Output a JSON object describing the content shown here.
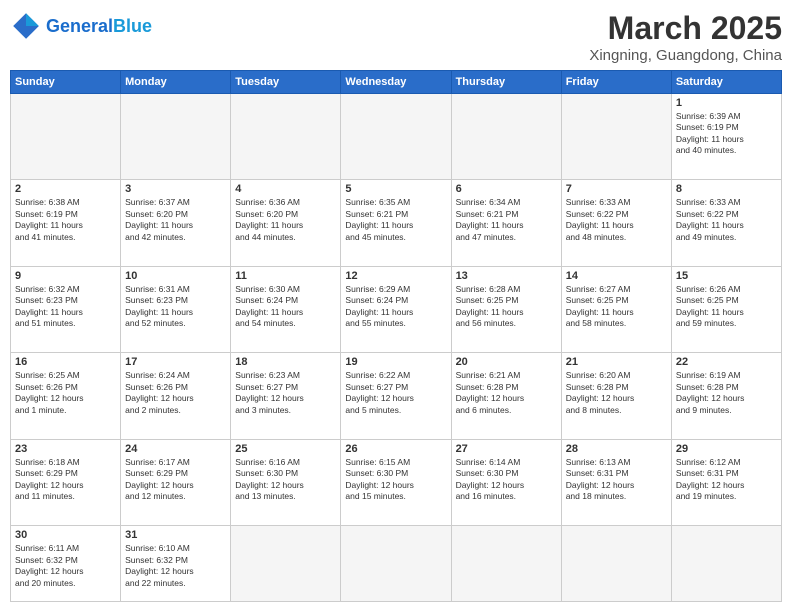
{
  "header": {
    "logo_general": "General",
    "logo_blue": "Blue",
    "month_title": "March 2025",
    "location": "Xingning, Guangdong, China"
  },
  "weekdays": [
    "Sunday",
    "Monday",
    "Tuesday",
    "Wednesday",
    "Thursday",
    "Friday",
    "Saturday"
  ],
  "days": [
    {
      "num": "",
      "info": "",
      "empty": true
    },
    {
      "num": "",
      "info": "",
      "empty": true
    },
    {
      "num": "",
      "info": "",
      "empty": true
    },
    {
      "num": "",
      "info": "",
      "empty": true
    },
    {
      "num": "",
      "info": "",
      "empty": true
    },
    {
      "num": "",
      "info": "",
      "empty": true
    },
    {
      "num": "1",
      "info": "Sunrise: 6:39 AM\nSunset: 6:19 PM\nDaylight: 11 hours\nand 40 minutes.",
      "empty": false
    },
    {
      "num": "2",
      "info": "Sunrise: 6:38 AM\nSunset: 6:19 PM\nDaylight: 11 hours\nand 41 minutes.",
      "empty": false
    },
    {
      "num": "3",
      "info": "Sunrise: 6:37 AM\nSunset: 6:20 PM\nDaylight: 11 hours\nand 42 minutes.",
      "empty": false
    },
    {
      "num": "4",
      "info": "Sunrise: 6:36 AM\nSunset: 6:20 PM\nDaylight: 11 hours\nand 44 minutes.",
      "empty": false
    },
    {
      "num": "5",
      "info": "Sunrise: 6:35 AM\nSunset: 6:21 PM\nDaylight: 11 hours\nand 45 minutes.",
      "empty": false
    },
    {
      "num": "6",
      "info": "Sunrise: 6:34 AM\nSunset: 6:21 PM\nDaylight: 11 hours\nand 47 minutes.",
      "empty": false
    },
    {
      "num": "7",
      "info": "Sunrise: 6:33 AM\nSunset: 6:22 PM\nDaylight: 11 hours\nand 48 minutes.",
      "empty": false
    },
    {
      "num": "8",
      "info": "Sunrise: 6:33 AM\nSunset: 6:22 PM\nDaylight: 11 hours\nand 49 minutes.",
      "empty": false
    },
    {
      "num": "9",
      "info": "Sunrise: 6:32 AM\nSunset: 6:23 PM\nDaylight: 11 hours\nand 51 minutes.",
      "empty": false
    },
    {
      "num": "10",
      "info": "Sunrise: 6:31 AM\nSunset: 6:23 PM\nDaylight: 11 hours\nand 52 minutes.",
      "empty": false
    },
    {
      "num": "11",
      "info": "Sunrise: 6:30 AM\nSunset: 6:24 PM\nDaylight: 11 hours\nand 54 minutes.",
      "empty": false
    },
    {
      "num": "12",
      "info": "Sunrise: 6:29 AM\nSunset: 6:24 PM\nDaylight: 11 hours\nand 55 minutes.",
      "empty": false
    },
    {
      "num": "13",
      "info": "Sunrise: 6:28 AM\nSunset: 6:25 PM\nDaylight: 11 hours\nand 56 minutes.",
      "empty": false
    },
    {
      "num": "14",
      "info": "Sunrise: 6:27 AM\nSunset: 6:25 PM\nDaylight: 11 hours\nand 58 minutes.",
      "empty": false
    },
    {
      "num": "15",
      "info": "Sunrise: 6:26 AM\nSunset: 6:25 PM\nDaylight: 11 hours\nand 59 minutes.",
      "empty": false
    },
    {
      "num": "16",
      "info": "Sunrise: 6:25 AM\nSunset: 6:26 PM\nDaylight: 12 hours\nand 1 minute.",
      "empty": false
    },
    {
      "num": "17",
      "info": "Sunrise: 6:24 AM\nSunset: 6:26 PM\nDaylight: 12 hours\nand 2 minutes.",
      "empty": false
    },
    {
      "num": "18",
      "info": "Sunrise: 6:23 AM\nSunset: 6:27 PM\nDaylight: 12 hours\nand 3 minutes.",
      "empty": false
    },
    {
      "num": "19",
      "info": "Sunrise: 6:22 AM\nSunset: 6:27 PM\nDaylight: 12 hours\nand 5 minutes.",
      "empty": false
    },
    {
      "num": "20",
      "info": "Sunrise: 6:21 AM\nSunset: 6:28 PM\nDaylight: 12 hours\nand 6 minutes.",
      "empty": false
    },
    {
      "num": "21",
      "info": "Sunrise: 6:20 AM\nSunset: 6:28 PM\nDaylight: 12 hours\nand 8 minutes.",
      "empty": false
    },
    {
      "num": "22",
      "info": "Sunrise: 6:19 AM\nSunset: 6:28 PM\nDaylight: 12 hours\nand 9 minutes.",
      "empty": false
    },
    {
      "num": "23",
      "info": "Sunrise: 6:18 AM\nSunset: 6:29 PM\nDaylight: 12 hours\nand 11 minutes.",
      "empty": false
    },
    {
      "num": "24",
      "info": "Sunrise: 6:17 AM\nSunset: 6:29 PM\nDaylight: 12 hours\nand 12 minutes.",
      "empty": false
    },
    {
      "num": "25",
      "info": "Sunrise: 6:16 AM\nSunset: 6:30 PM\nDaylight: 12 hours\nand 13 minutes.",
      "empty": false
    },
    {
      "num": "26",
      "info": "Sunrise: 6:15 AM\nSunset: 6:30 PM\nDaylight: 12 hours\nand 15 minutes.",
      "empty": false
    },
    {
      "num": "27",
      "info": "Sunrise: 6:14 AM\nSunset: 6:30 PM\nDaylight: 12 hours\nand 16 minutes.",
      "empty": false
    },
    {
      "num": "28",
      "info": "Sunrise: 6:13 AM\nSunset: 6:31 PM\nDaylight: 12 hours\nand 18 minutes.",
      "empty": false
    },
    {
      "num": "29",
      "info": "Sunrise: 6:12 AM\nSunset: 6:31 PM\nDaylight: 12 hours\nand 19 minutes.",
      "empty": false
    },
    {
      "num": "30",
      "info": "Sunrise: 6:11 AM\nSunset: 6:32 PM\nDaylight: 12 hours\nand 20 minutes.",
      "empty": false
    },
    {
      "num": "31",
      "info": "Sunrise: 6:10 AM\nSunset: 6:32 PM\nDaylight: 12 hours\nand 22 minutes.",
      "empty": false
    },
    {
      "num": "",
      "info": "",
      "empty": true
    },
    {
      "num": "",
      "info": "",
      "empty": true
    },
    {
      "num": "",
      "info": "",
      "empty": true
    },
    {
      "num": "",
      "info": "",
      "empty": true
    },
    {
      "num": "",
      "info": "",
      "empty": true
    }
  ]
}
